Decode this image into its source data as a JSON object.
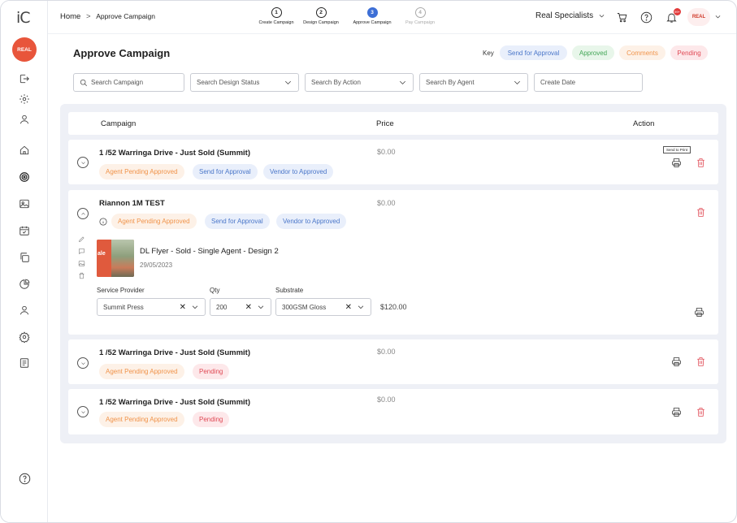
{
  "sidebar": {
    "logo": "iC",
    "brand": "REAL",
    "icons": [
      "logout-icon",
      "settings-icon",
      "user-icon",
      "home-icon",
      "target-icon",
      "image-icon",
      "calendar-icon",
      "copy-icon",
      "pie-chart-icon",
      "user-icon",
      "gear-icon",
      "document-icon",
      "help-icon"
    ]
  },
  "topbar": {
    "breadcrumb_home": "Home",
    "breadcrumb_sep": ">",
    "breadcrumb_current": "Approve Campaign",
    "steps": [
      {
        "num": "1",
        "label": "Create Campaign",
        "state": "done"
      },
      {
        "num": "2",
        "label": "Design Campaign",
        "state": "done"
      },
      {
        "num": "3",
        "label": "Approve Campaign",
        "state": "active"
      },
      {
        "num": "4",
        "label": "Pay Campaign",
        "state": "disabled"
      }
    ],
    "org": "Real Specialists",
    "notif_count": "99+",
    "avatar_text": "REAL"
  },
  "header": {
    "title": "Approve Campaign",
    "key_label": "Key",
    "key": [
      "Send for Approval",
      "Approved",
      "Comments",
      "Pending"
    ]
  },
  "filters": {
    "search_placeholder": "Search Campaign",
    "design_status": "Search Design Status",
    "action": "Search By Action",
    "agent": "Search By Agent",
    "date": "Create Date"
  },
  "table": {
    "col_campaign": "Campaign",
    "col_price": "Price",
    "col_action": "Action",
    "tooltip": "Send to Print",
    "rows": [
      {
        "title": "1 /52 Warringa Drive - Just Sold (Summit)",
        "price": "$0.00",
        "tags": [
          "Agent Pending Approved",
          "Send for Approval",
          "Vendor to Approved"
        ]
      },
      {
        "title": "Riannon 1M TEST",
        "price": "$0.00",
        "tags": [
          "Agent Pending Approved",
          "Send for Approval",
          "Vendor to Approved"
        ],
        "item": {
          "name": "DL Flyer - Sold - Single Agent - Design 2",
          "date": "29/05/2023",
          "service_provider_label": "Service Provider",
          "qty_label": "Qty",
          "substrate_label": "Substrate",
          "service_provider": "Summit Press",
          "qty": "200",
          "substrate": "300GSM Gloss",
          "total": "$120.00",
          "thumb_text": "ale"
        }
      },
      {
        "title": "1 /52 Warringa Drive - Just Sold (Summit)",
        "price": "$0.00",
        "tags": [
          "Agent Pending Approved",
          "Pending"
        ]
      },
      {
        "title": "1 /52 Warringa Drive - Just Sold (Summit)",
        "price": "$0.00",
        "tags": [
          "Agent Pending Approved",
          "Pending"
        ]
      }
    ]
  },
  "colors": {
    "accent": "#3d6fd6",
    "brand": "#e8553b",
    "danger": "#e04a55"
  }
}
